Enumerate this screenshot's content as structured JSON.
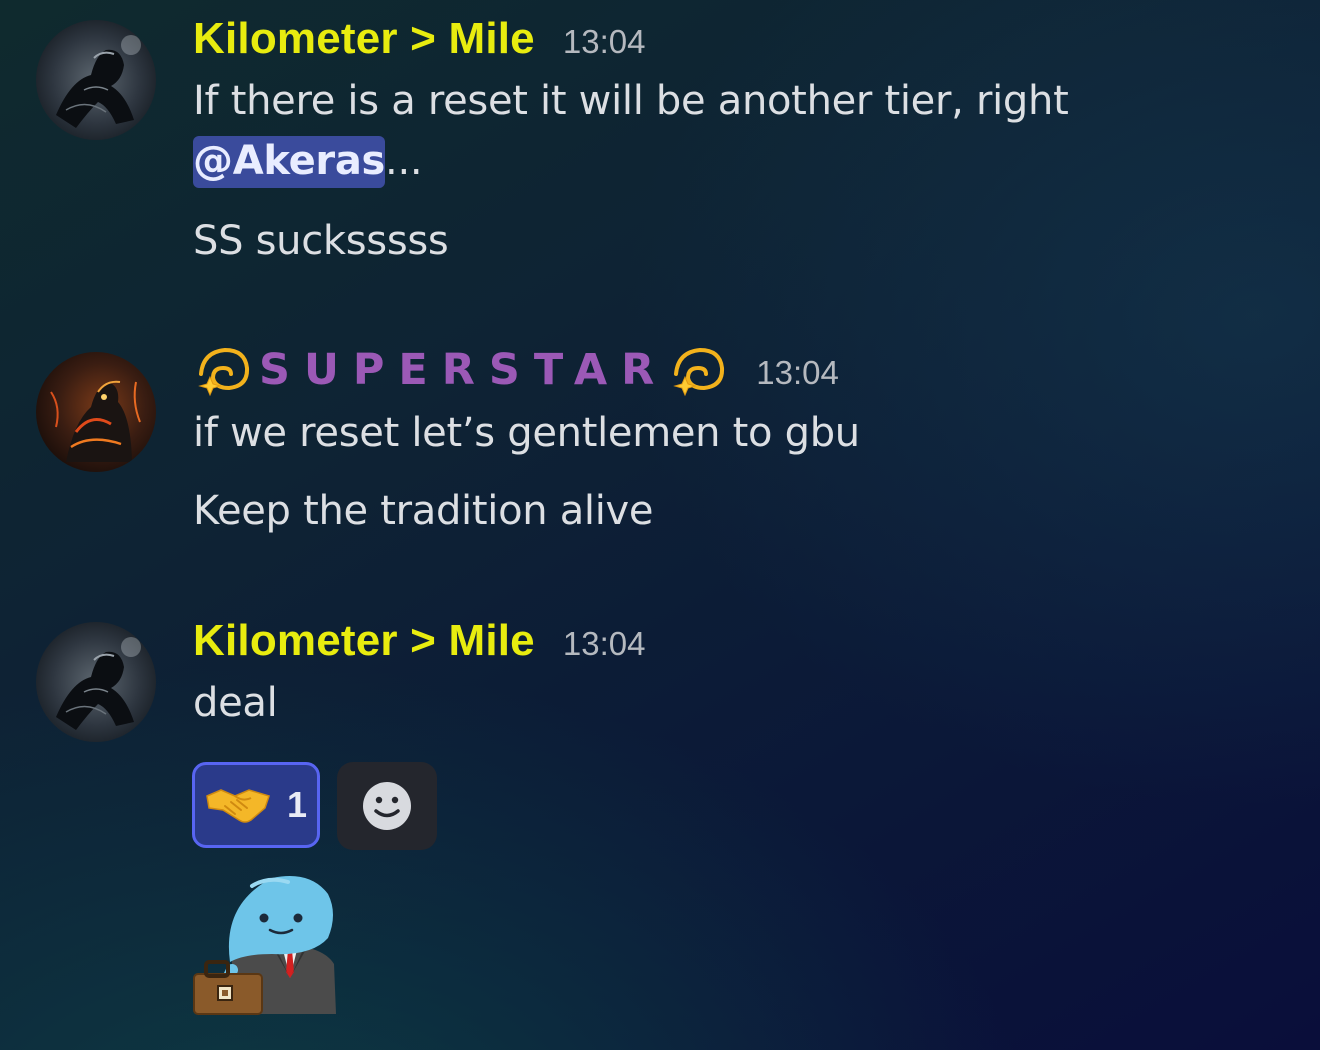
{
  "messages": [
    {
      "author": "Kilometer > Mile",
      "time": "13:04",
      "lines": {
        "first_text": "If there is a reset it will be another tier, right",
        "mention": "@Akeras",
        "mention_suffix": "...",
        "second": "SS sucksssss"
      }
    },
    {
      "author_prefix_emoji": "dizzy-icon",
      "author": "SUPERSTAR",
      "author_suffix_emoji": "dizzy-icon",
      "time": "13:04",
      "lines": {
        "first": "if we reset let’s gentlemen to gbu",
        "second": "Keep the tradition alive"
      }
    },
    {
      "author": "Kilometer > Mile",
      "time": "13:04",
      "lines": {
        "first": "deal"
      },
      "reactions": [
        {
          "emoji": "handshake-icon",
          "count": "1"
        }
      ],
      "add_reaction_icon": "smiley-add-reaction-icon",
      "sticker": "blob-businessman-sticker"
    }
  ],
  "colors": {
    "username_kilometer": "#e8ec0f",
    "username_superstar": "#9b59b6",
    "mention_bg": "#3a4b9c",
    "reaction_border": "#5865f2"
  }
}
